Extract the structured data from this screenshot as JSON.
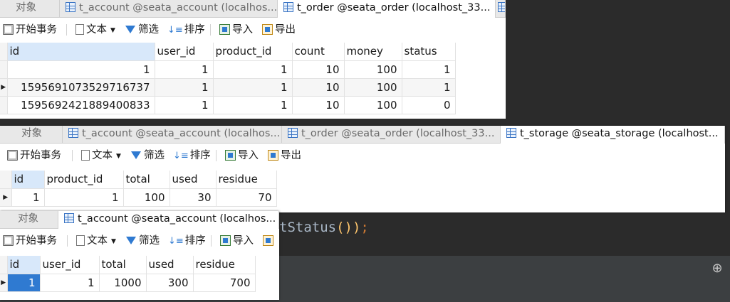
{
  "code": {
    "fragment": "tStatus",
    "parens": "())",
    "semi": ";"
  },
  "toolbar": {
    "begin_tx": "开始事务",
    "text": "文本",
    "filter": "筛选",
    "sort": "排序",
    "import": "导入",
    "export": "导出"
  },
  "window1": {
    "tabs": [
      "对象",
      "t_account @seata_account (localhos...",
      "t_order @seata_order (localhost_33...",
      ""
    ],
    "columns": [
      "id",
      "user_id",
      "product_id",
      "count",
      "money",
      "status"
    ],
    "rows": [
      [
        "1",
        "1",
        "1",
        "10",
        "100",
        "1"
      ],
      [
        "1595691073529716737",
        "1",
        "1",
        "10",
        "100",
        "1"
      ],
      [
        "1595692421889400833",
        "1",
        "1",
        "10",
        "100",
        "0"
      ]
    ]
  },
  "window2": {
    "tabs": [
      "对象",
      "t_account @seata_account (localhos...",
      "t_order @seata_order (localhost_33...",
      "t_storage @seata_storage (localhost..."
    ],
    "columns": [
      "id",
      "product_id",
      "total",
      "used",
      "residue"
    ],
    "rows": [
      [
        "1",
        "1",
        "100",
        "30",
        "70"
      ]
    ]
  },
  "window3": {
    "tabs": [
      "对象",
      "t_account @seata_account (localhos..."
    ],
    "columns": [
      "id",
      "user_id",
      "total",
      "used",
      "residue"
    ],
    "rows": [
      [
        "1",
        "1",
        "1000",
        "300",
        "700"
      ]
    ]
  }
}
